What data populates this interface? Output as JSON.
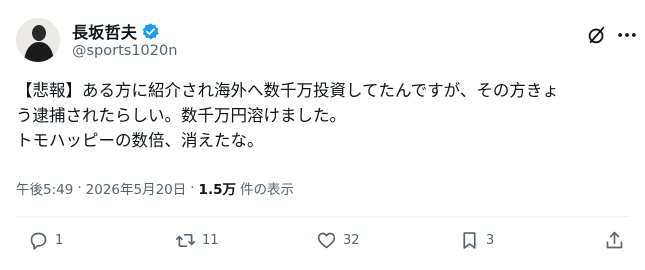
{
  "author": {
    "display_name": "長坂哲夫",
    "handle": "@sports1020n",
    "avatar_icon": "user-avatar-icon",
    "verified_icon": "verified-badge-icon",
    "verified_color": "#1d9bf0"
  },
  "header_icons": {
    "grok": "grok-icon",
    "more": "more-icon"
  },
  "post": {
    "lines": [
      "【悲報】ある方に紹介され海外へ数千万投資してたんですが、その方きょ",
      "う逮捕されたらしい。数千万円溶けました。",
      "トモハッピーの数倍、消えたな。"
    ]
  },
  "meta": {
    "time": "午後5:49",
    "separator": "·",
    "date": "2026年5月20日",
    "views_count": "1.5万",
    "views_label": "件の表示"
  },
  "actions": {
    "reply": {
      "icon": "reply-icon",
      "count": "1"
    },
    "repost": {
      "icon": "repost-icon",
      "count": "11"
    },
    "like": {
      "icon": "like-icon",
      "count": "32"
    },
    "bookmark": {
      "icon": "bookmark-icon",
      "count": "3"
    },
    "share": {
      "icon": "share-icon"
    }
  }
}
